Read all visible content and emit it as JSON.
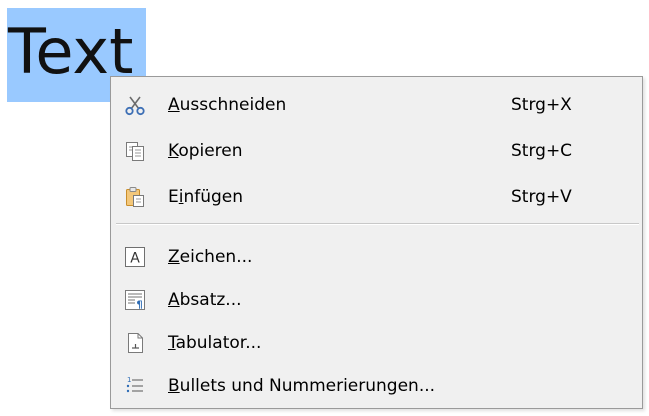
{
  "document": {
    "selected_text": "Text",
    "selection_color": "#99c9ff"
  },
  "context_menu": {
    "items": [
      {
        "id": "cut",
        "pre": "",
        "mnemonic": "A",
        "post": "usschneiden",
        "shortcut": "Strg+X",
        "icon": "scissors-icon"
      },
      {
        "id": "copy",
        "pre": "",
        "mnemonic": "K",
        "post": "opieren",
        "shortcut": "Strg+C",
        "icon": "copy-icon"
      },
      {
        "id": "paste",
        "pre": "E",
        "mnemonic": "i",
        "post": "nfügen",
        "shortcut": "Strg+V",
        "icon": "paste-icon"
      },
      {
        "id": "character",
        "pre": "",
        "mnemonic": "Z",
        "post": "eichen...",
        "shortcut": "",
        "icon": "character-icon"
      },
      {
        "id": "paragraph",
        "pre": "",
        "mnemonic": "A",
        "post": "bsatz...",
        "shortcut": "",
        "icon": "paragraph-icon"
      },
      {
        "id": "tabs",
        "pre": "",
        "mnemonic": "T",
        "post": "abulator...",
        "shortcut": "",
        "icon": "tabs-icon"
      },
      {
        "id": "bullets",
        "pre": "",
        "mnemonic": "B",
        "post": "ullets und Nummerierungen...",
        "shortcut": "",
        "icon": "bullets-numbering-icon"
      }
    ]
  }
}
